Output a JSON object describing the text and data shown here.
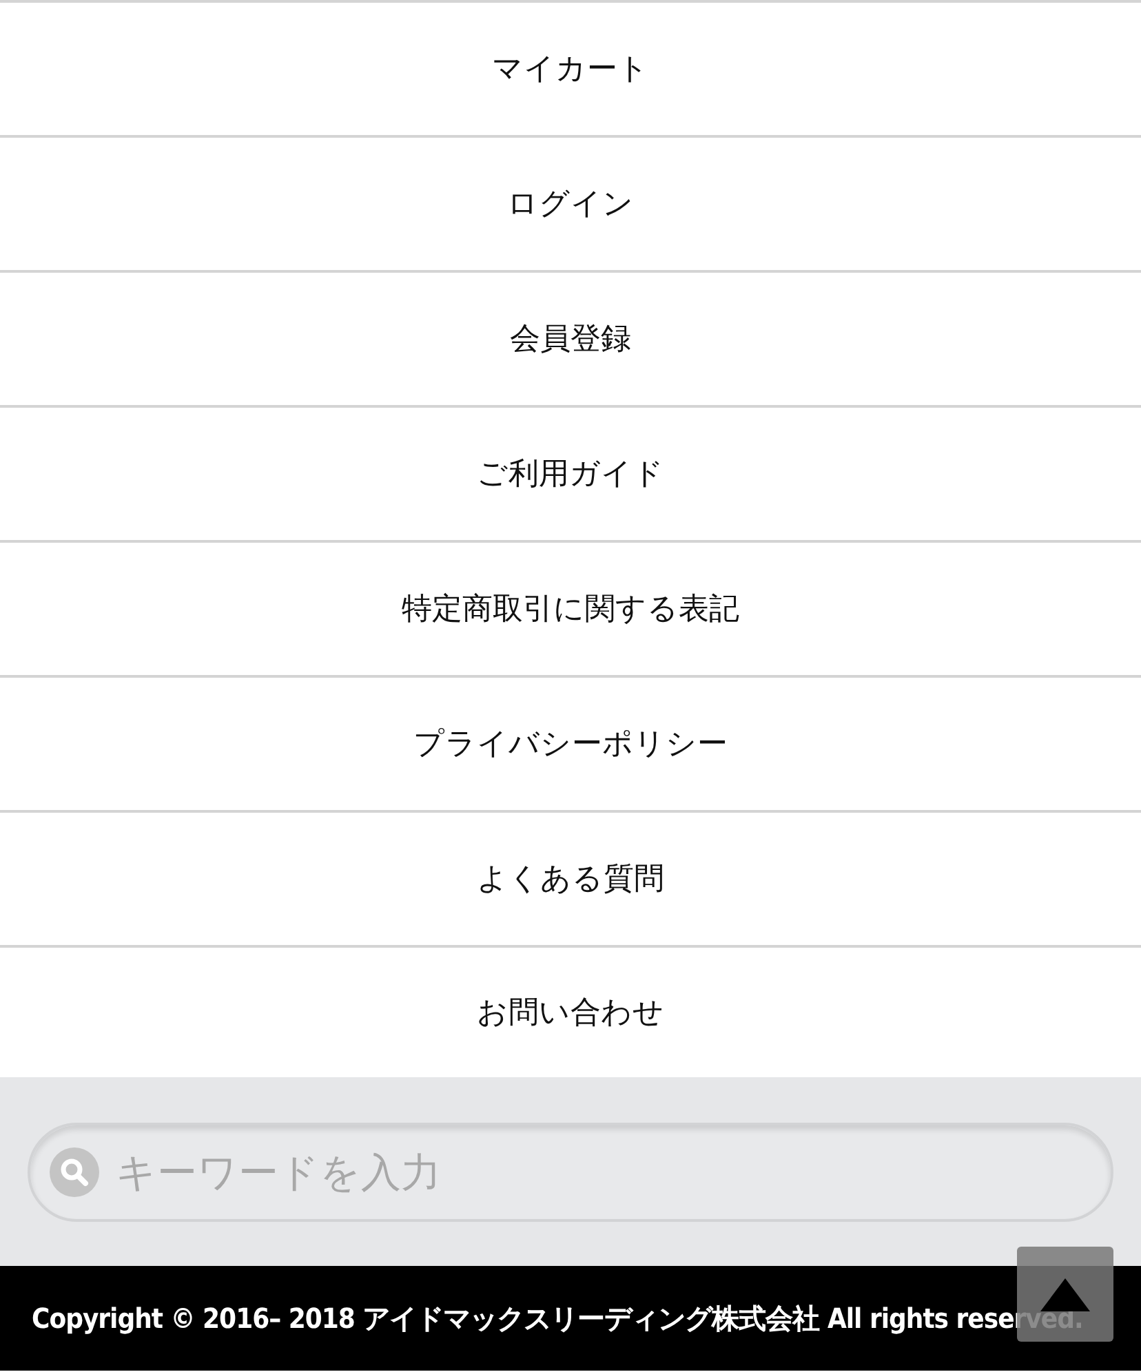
{
  "menu": [
    {
      "label": "マイカート"
    },
    {
      "label": "ログイン"
    },
    {
      "label": "会員登録"
    },
    {
      "label": "ご利用ガイド"
    },
    {
      "label": "特定商取引に関する表記"
    },
    {
      "label": "プライバシーポリシー"
    },
    {
      "label": "よくある質問"
    },
    {
      "label": "お問い合わせ"
    }
  ],
  "search": {
    "placeholder": "キーワードを入力"
  },
  "footer": {
    "copyright": "Copyright © 2016– 2018 アイドマックスリーディング株式会社 All rights reserved."
  }
}
